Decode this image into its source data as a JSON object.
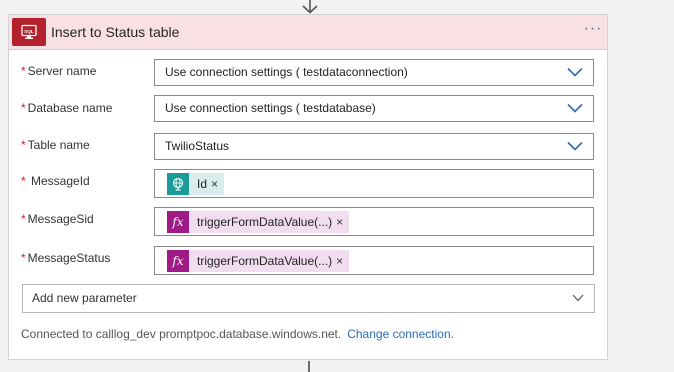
{
  "action": {
    "title": "Insert to Status table",
    "icon": "sql-server-icon",
    "more_icon": "ellipsis-icon",
    "brand_color": "#b3212c",
    "header_bg": "#f9e0e3"
  },
  "fields": {
    "server": {
      "required_mark": "*",
      "label": "Server name",
      "value": "Use connection settings ( testdataconnection)"
    },
    "database": {
      "required_mark": "*",
      "label": "Database name",
      "value": "Use connection settings ( testdatabase)"
    },
    "table": {
      "required_mark": "*",
      "label": "Table name",
      "value": "TwilioStatus"
    },
    "message_id": {
      "required_mark": "*",
      "label": "MessageId",
      "token": {
        "text": "Id",
        "close": "×",
        "icon": "globe-request-icon",
        "color": "#1a9b9a"
      }
    },
    "message_sid": {
      "required_mark": "*",
      "label": "MessageSid",
      "token": {
        "text": "triggerFormDataValue(...)",
        "close": "×",
        "icon": "fx-icon",
        "icon_text": "fx",
        "color": "#a01a86"
      }
    },
    "message_status": {
      "required_mark": "*",
      "label": "MessageStatus",
      "token": {
        "text": "triggerFormDataValue(...)",
        "close": "×",
        "icon": "fx-icon",
        "icon_text": "fx",
        "color": "#a01a86"
      }
    }
  },
  "add_parameter": {
    "label": "Add new parameter"
  },
  "footer": {
    "connected_text": "Connected to calllog_dev promptpoc.database.windows.net.",
    "change_link": "Change connection."
  }
}
